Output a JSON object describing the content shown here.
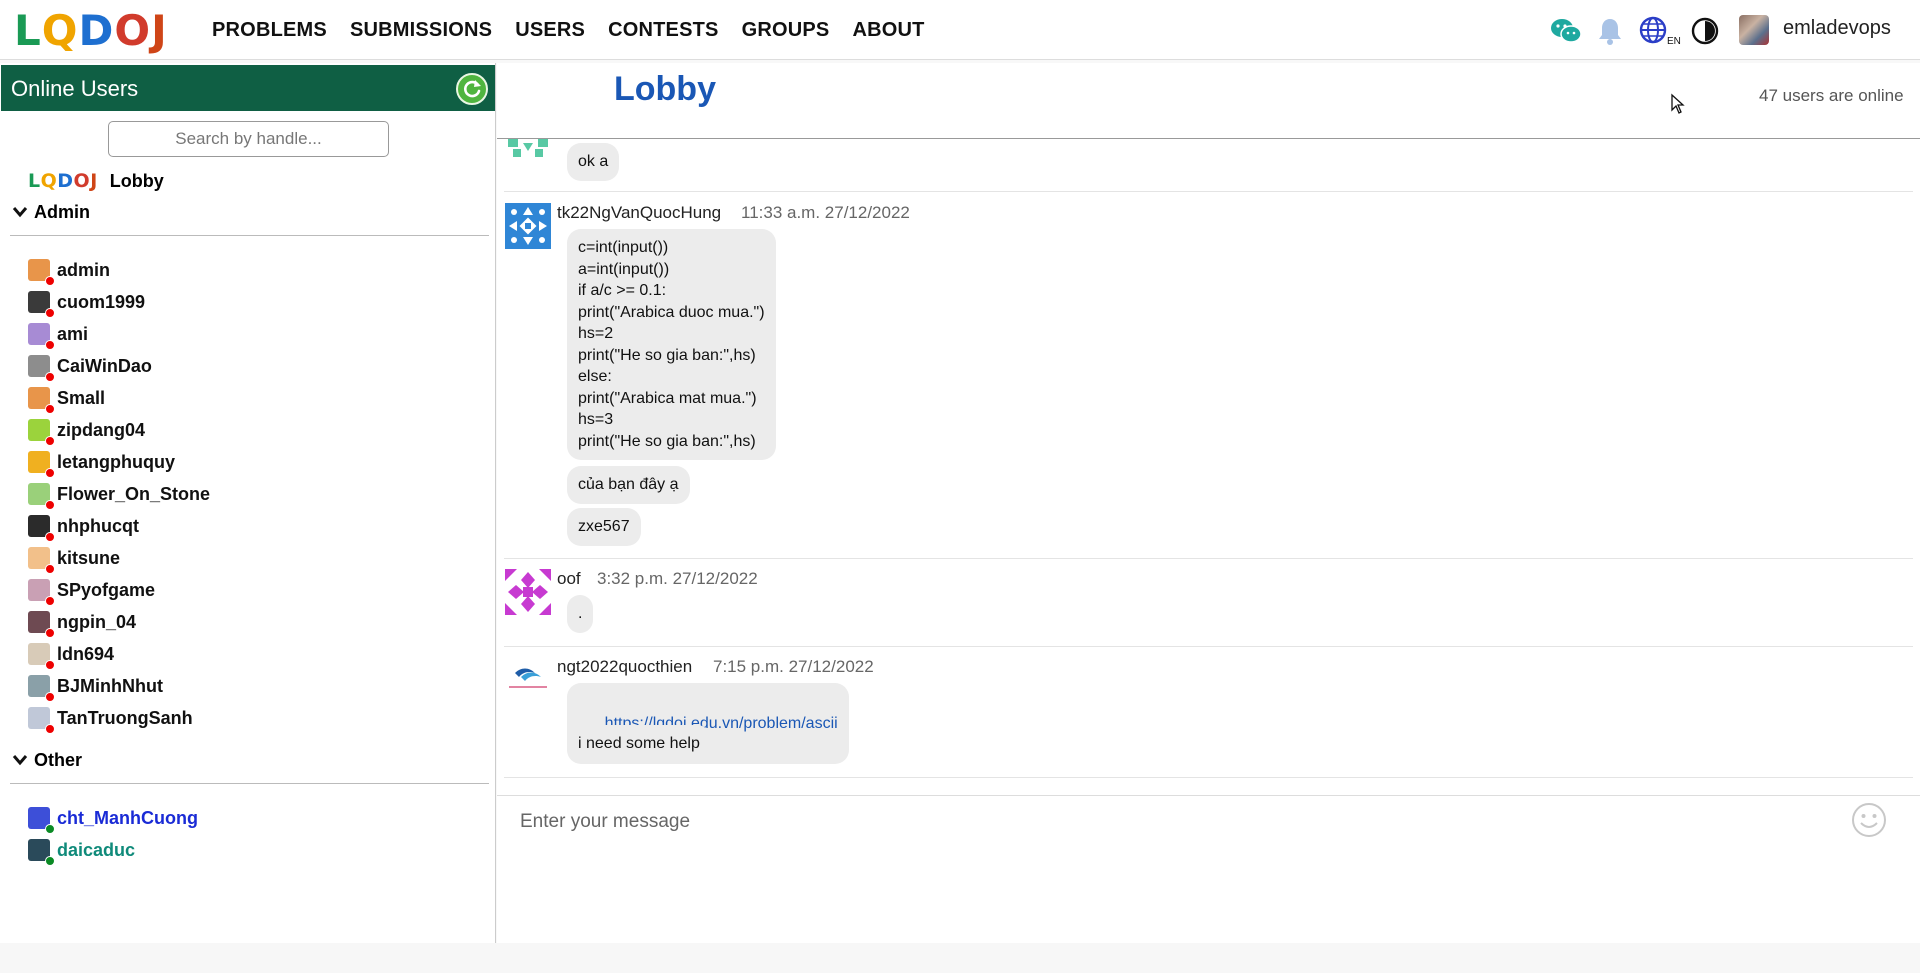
{
  "nav": {
    "logo_letters": [
      "L",
      "Q",
      "D",
      "O",
      "J"
    ],
    "logo_colors": [
      "#1a9a55",
      "#f0a400",
      "#1e6fd0",
      "#d13b2c",
      "#cf4517"
    ],
    "links": [
      "PROBLEMS",
      "SUBMISSIONS",
      "USERS",
      "CONTESTS",
      "GROUPS",
      "ABOUT"
    ],
    "language_badge": "EN",
    "username": "emladevops"
  },
  "sidebar": {
    "title": "Online Users",
    "search_placeholder": "Search by handle...",
    "lobby_label": "Lobby",
    "groups": [
      {
        "title": "Admin",
        "users": [
          {
            "name": "admin",
            "color": "#111111",
            "avatar": "#e8954a",
            "online": false
          },
          {
            "name": "cuom1999",
            "color": "#111111",
            "avatar": "#3a3a3a",
            "online": false
          },
          {
            "name": "ami",
            "color": "#111111",
            "avatar": "#a78bd4",
            "online": false
          },
          {
            "name": "CaiWinDao",
            "color": "#111111",
            "avatar": "#8d8d8d",
            "online": false
          },
          {
            "name": "Small",
            "color": "#111111",
            "avatar": "#e8954a",
            "online": false
          },
          {
            "name": "zipdang04",
            "color": "#111111",
            "avatar": "#9bd33c",
            "online": false
          },
          {
            "name": "letangphuquy",
            "color": "#111111",
            "avatar": "#f0b020",
            "online": false
          },
          {
            "name": "Flower_On_Stone",
            "color": "#111111",
            "avatar": "#9ad07a",
            "online": false
          },
          {
            "name": "nhphucqt",
            "color": "#111111",
            "avatar": "#2b2b2b",
            "online": false
          },
          {
            "name": "kitsune",
            "color": "#111111",
            "avatar": "#f2c08a",
            "online": false
          },
          {
            "name": "SPyofgame",
            "color": "#111111",
            "avatar": "#c9a0b4",
            "online": false
          },
          {
            "name": "ngpin_04",
            "color": "#111111",
            "avatar": "#6e4a52",
            "online": false
          },
          {
            "name": "ldn694",
            "color": "#111111",
            "avatar": "#d8cbb8",
            "online": false
          },
          {
            "name": "BJMinhNhut",
            "color": "#111111",
            "avatar": "#8aa0a8",
            "online": false
          },
          {
            "name": "TanTruongSanh",
            "color": "#111111",
            "avatar": "#c0c8d8",
            "online": false
          }
        ]
      },
      {
        "title": "Other",
        "users": [
          {
            "name": "cht_ManhCuong",
            "color": "#1a2bd6",
            "avatar": "#3d4fd8",
            "online": true
          },
          {
            "name": "daicaduc",
            "color": "#0f8a7a",
            "avatar": "#2a4a5a",
            "online": true
          }
        ]
      }
    ]
  },
  "chat": {
    "room_title": "Lobby",
    "online_count": "47 users are online",
    "messages": [
      {
        "author": "",
        "time": "",
        "avatar": "#58c9a4",
        "bubbles": [
          "ok a"
        ]
      },
      {
        "author": "tk22NgVanQuocHung",
        "time": "11:33 a.m. 27/12/2022",
        "avatar": "#2f86d6",
        "bubbles": [
          "c=int(input())\na=int(input())\nif a/c >= 0.1:\nprint(\"Arabica duoc mua.\")\nhs=2\nprint(\"He so gia ban:\",hs)\nelse:\nprint(\"Arabica mat mua.\")\nhs=3\nprint(\"He so gia ban:\",hs)",
          "của bạn đây ạ",
          "zxe567"
        ]
      },
      {
        "author": "oof",
        "time": "3:32 p.m. 27/12/2022",
        "avatar": "#c73ad1",
        "bubbles": [
          "."
        ]
      },
      {
        "author": "ngt2022quocthien",
        "time": "7:15 p.m. 27/12/2022",
        "avatar": "#1f5da8",
        "bubbles": [
          "https://lqdoj.edu.vn/problem/ascii",
          "i need some help"
        ]
      }
    ],
    "composer_placeholder": "Enter your message"
  }
}
